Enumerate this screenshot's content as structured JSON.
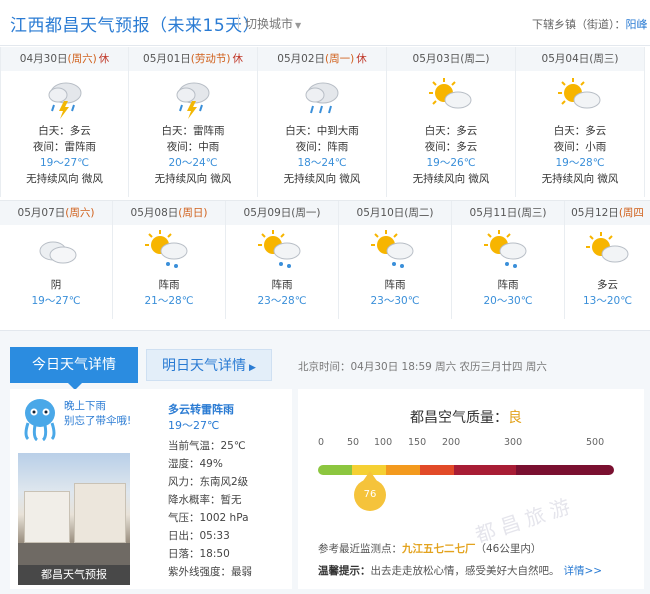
{
  "header": {
    "title": "江西都昌天气预报（未来15天）",
    "switch_city": "切换城市",
    "town_label": "下辖乡镇（街道）：",
    "town_link": "阳峰"
  },
  "forecast_row1": [
    {
      "date": "04月30日",
      "weekday": "(周六)",
      "rest": "休",
      "icon": "thunder-rain-icon",
      "day": "白天：多云",
      "night": "夜间：雷阵雨",
      "temp": "19～27℃",
      "wind": "无持续风向 微风"
    },
    {
      "date": "05月01日",
      "weekday": "(劳动节)",
      "rest": "休",
      "icon": "thunder-rain-icon",
      "day": "白天：雷阵雨",
      "night": "夜间：中雨",
      "temp": "20～24℃",
      "wind": "无持续风向 微风"
    },
    {
      "date": "05月02日",
      "weekday": "(周一)",
      "rest": "休",
      "icon": "rain-icon",
      "day": "白天：中到大雨",
      "night": "夜间：阵雨",
      "temp": "18～24℃",
      "wind": "无持续风向 微风"
    },
    {
      "date": "05月03日",
      "weekday": "(周二)",
      "rest": "",
      "icon": "partly-cloudy-icon",
      "day": "白天：多云",
      "night": "夜间：多云",
      "temp": "19～26℃",
      "wind": "无持续风向 微风"
    },
    {
      "date": "05月04日",
      "weekday": "(周三)",
      "rest": "",
      "icon": "partly-cloudy-icon",
      "day": "白天：多云",
      "night": "夜间：小雨",
      "temp": "19～28℃",
      "wind": "无持续风向 微风"
    }
  ],
  "forecast_row2": [
    {
      "date": "05月07日",
      "weekday": "(周六)",
      "icon": "overcast-icon",
      "cond": "阴",
      "temp": "19～27℃"
    },
    {
      "date": "05月08日",
      "weekday": "(周日)",
      "icon": "sun-rain-icon",
      "cond": "阵雨",
      "temp": "21～28℃"
    },
    {
      "date": "05月09日",
      "weekday": "(周一)",
      "icon": "sun-rain-icon",
      "cond": "阵雨",
      "temp": "23～28℃"
    },
    {
      "date": "05月10日",
      "weekday": "(周二)",
      "icon": "sun-rain-icon",
      "cond": "阵雨",
      "temp": "23～30℃"
    },
    {
      "date": "05月11日",
      "weekday": "(周三)",
      "icon": "sun-rain-icon",
      "cond": "阵雨",
      "temp": "20～30℃"
    },
    {
      "date": "05月12日",
      "weekday": "(周四",
      "icon": "partly-cloudy-icon",
      "cond": "多云",
      "temp": "13～20℃"
    }
  ],
  "tabs": {
    "today": "今日天气详情",
    "tomorrow": "明日天气详情"
  },
  "clock": "北京时间：04月30日  18:59  周六    农历三月廿四  周六",
  "today": {
    "mascot_line1": "晚上下雨",
    "mascot_line2": "别忘了带伞哦!",
    "photo_caption": "都昌天气预报",
    "title": "多云转雷阵雨",
    "temp": "19～27℃",
    "stats": [
      "当前气温：25℃",
      "湿度：49%",
      "风力：东南风2级",
      "降水概率：暂无",
      "气压：1002 hPa",
      "日出：05:33",
      "日落：18:50",
      "紫外线强度：最弱"
    ]
  },
  "air": {
    "title": "都昌空气质量：",
    "level": "良",
    "scale": [
      "0",
      "50",
      "100",
      "150",
      "200",
      "300",
      "500"
    ],
    "value": "76",
    "value_num": 76,
    "colors": [
      "#8cc63f",
      "#f5d033",
      "#f39a1e",
      "#e24a28",
      "#a81d35",
      "#7a1030"
    ],
    "station_label": "参考最近监测点：",
    "station_name": "九江五七二七厂",
    "station_dist": "（46公里内）",
    "tip_label": "温馨提示：",
    "tip_text": "出去走走放松心情，感受美好大自然吧。",
    "tip_more": "详情>>",
    "watermark": "都昌旅游"
  }
}
